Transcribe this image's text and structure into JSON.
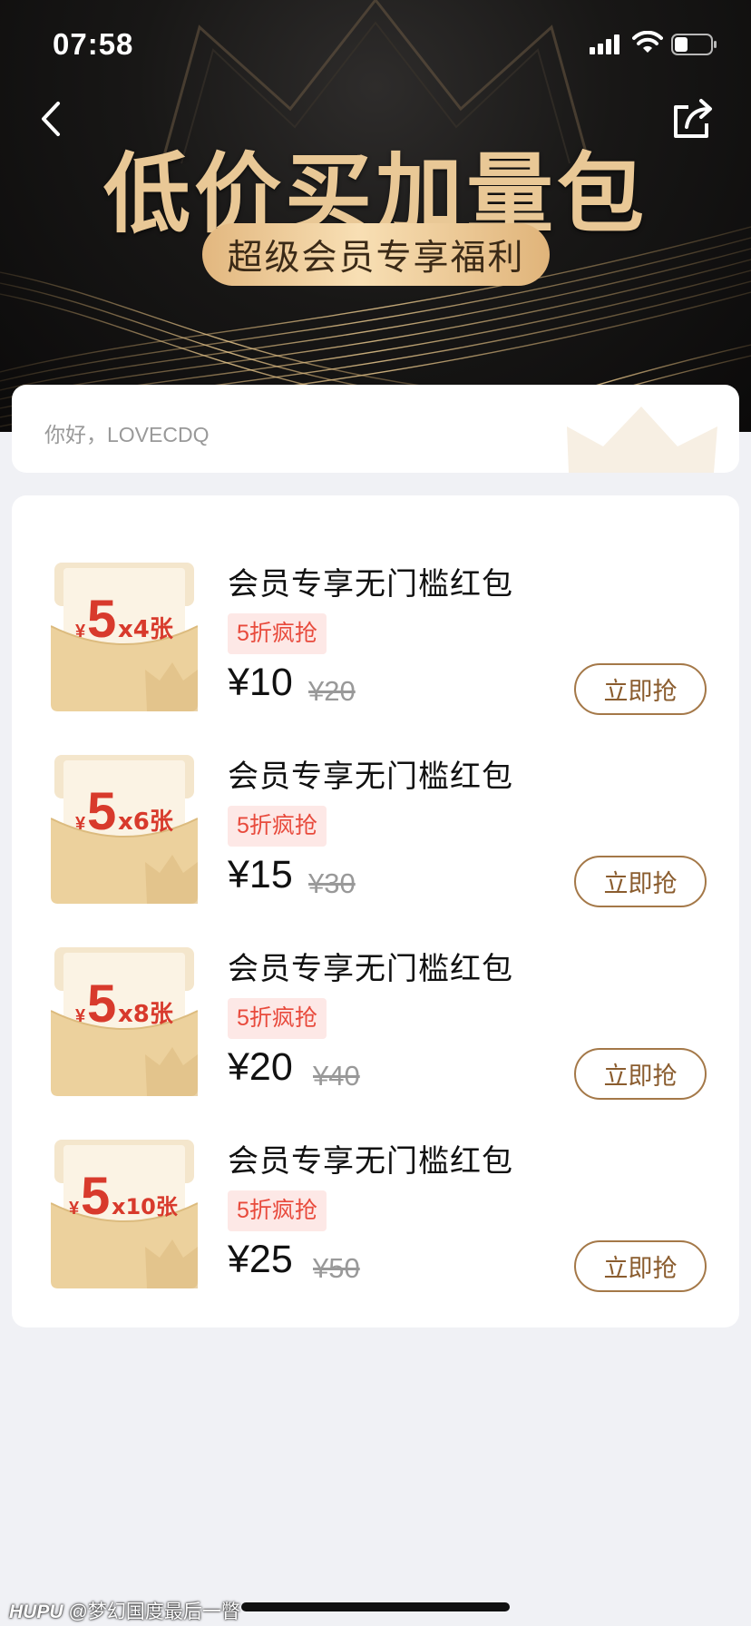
{
  "status_bar": {
    "time": "07:58"
  },
  "hero": {
    "title": "低价买加量包",
    "badge": "超级会员专享福利",
    "colors": {
      "gold": "#e9c896",
      "bg": "#141312"
    }
  },
  "icons": {
    "back": "chevron-left-icon",
    "share": "share-icon"
  },
  "greeting": {
    "text": "你好，LOVECDQ"
  },
  "items": [
    {
      "title": "会员专享无门槛红包",
      "tag": "5折疯抢",
      "price": "¥10",
      "original_price": "¥20",
      "button": "立即抢",
      "thumb": {
        "yen": "¥",
        "amount": "5",
        "count": "x4张"
      }
    },
    {
      "title": "会员专享无门槛红包",
      "tag": "5折疯抢",
      "price": "¥15",
      "original_price": "¥30",
      "button": "立即抢",
      "thumb": {
        "yen": "¥",
        "amount": "5",
        "count": "x6张"
      }
    },
    {
      "title": "会员专享无门槛红包",
      "tag": "5折疯抢",
      "price": "¥20",
      "original_price": "¥40",
      "button": "立即抢",
      "thumb": {
        "yen": "¥",
        "amount": "5",
        "count": "x8张"
      }
    },
    {
      "title": "会员专享无门槛红包",
      "tag": "5折疯抢",
      "price": "¥25",
      "original_price": "¥50",
      "button": "立即抢",
      "thumb": {
        "yen": "¥",
        "amount": "5",
        "count": "x10张"
      }
    }
  ],
  "watermark": {
    "brand": "HUPU",
    "text": "@梦幻国度最后一瞥"
  }
}
